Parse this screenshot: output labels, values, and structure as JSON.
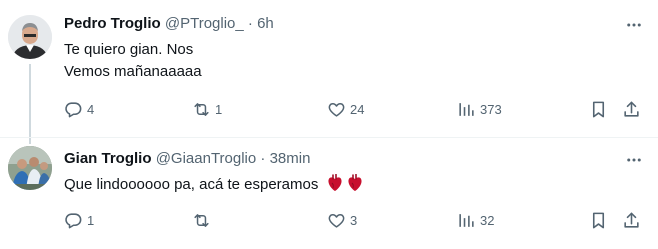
{
  "tweets": [
    {
      "name": "Pedro Troglio",
      "handle": "@PTroglio_",
      "time": "6h",
      "text_lines": [
        "Te quiero gian. Nos",
        "Vemos mañanaaaaa"
      ],
      "replies": "4",
      "retweets": "1",
      "likes": "24",
      "views": "373"
    },
    {
      "name": "Gian Troglio",
      "handle": "@GiaanTroglio",
      "time": "38min",
      "text": "Que lindoooooo pa, acá te esperamos",
      "emoji": "anatomical-heart",
      "replies": "1",
      "retweets": "",
      "likes": "3",
      "views": "32"
    }
  ],
  "separator": " · ",
  "icons": {
    "reply": "reply-icon",
    "retweet": "retweet-icon",
    "like": "heart-icon",
    "views": "views-icon",
    "bookmark": "bookmark-icon",
    "share": "share-icon",
    "more": "more-icon"
  },
  "colors": {
    "text": "#0f1419",
    "secondary": "#536471",
    "thread_line": "#cfd9de",
    "divider": "#eff3f4"
  }
}
